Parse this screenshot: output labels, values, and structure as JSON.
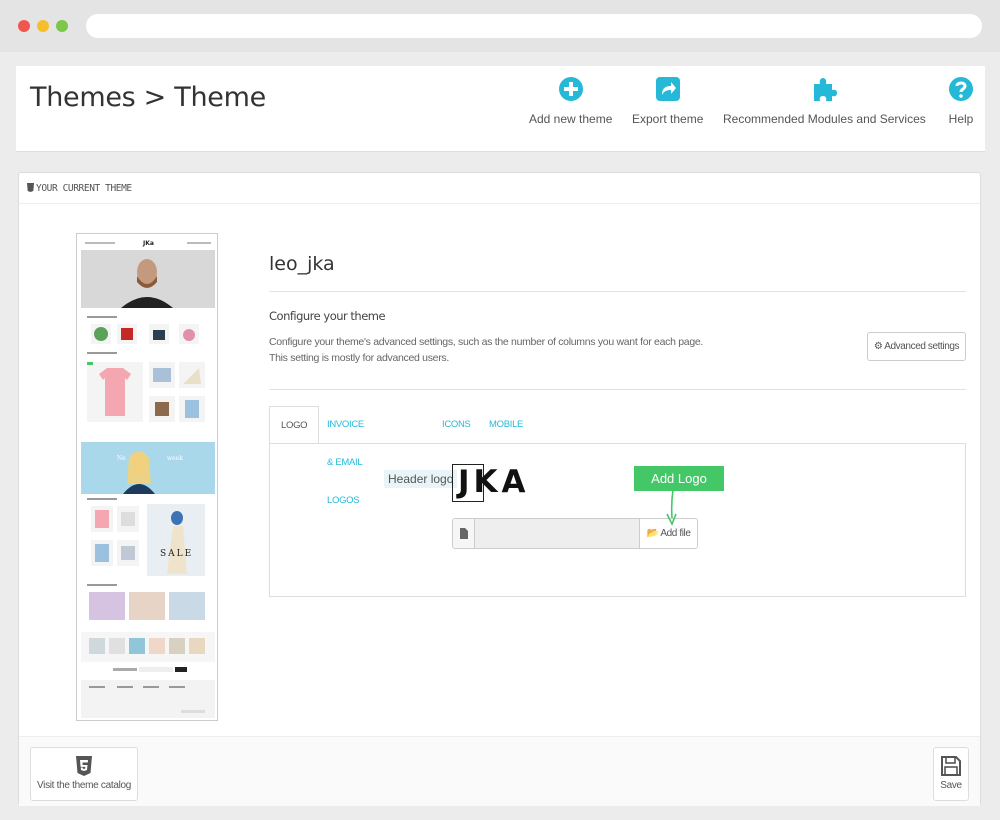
{
  "page": {
    "title": "Themes > Theme"
  },
  "toolbar": {
    "items": [
      {
        "label": "Add new theme",
        "icon": "plus-circle-icon"
      },
      {
        "label": "Export theme",
        "icon": "export-icon"
      },
      {
        "label": "Recommended Modules and Services",
        "icon": "puzzle-icon"
      },
      {
        "label": "Help",
        "icon": "help-icon"
      }
    ],
    "accent": "#25b9d7"
  },
  "panel": {
    "heading": "Your current theme",
    "theme_name": "leo_jka",
    "configure_title": "Configure your theme",
    "configure_desc": "Configure your theme's advanced settings, such as the number of columns you want for each page. This setting is mostly for advanced users.",
    "advanced_button": "Advanced settings"
  },
  "tabs": [
    {
      "label": "Logo",
      "active": true
    },
    {
      "label": "Invoice & Email Logos",
      "active": false
    },
    {
      "label": "Icons",
      "active": false
    },
    {
      "label": "Mobile",
      "active": false
    }
  ],
  "logo_tab": {
    "header_logo_label": "Header logo",
    "logo_text": "JKA",
    "add_file_button": "Add file",
    "callout": "Add Logo",
    "callout_color": "#44c767"
  },
  "thumbnail": {
    "logo": "JKa",
    "sale_text": "SALE"
  },
  "footer": {
    "catalog_button": "Visit the theme catalog",
    "save_button": "Save"
  }
}
